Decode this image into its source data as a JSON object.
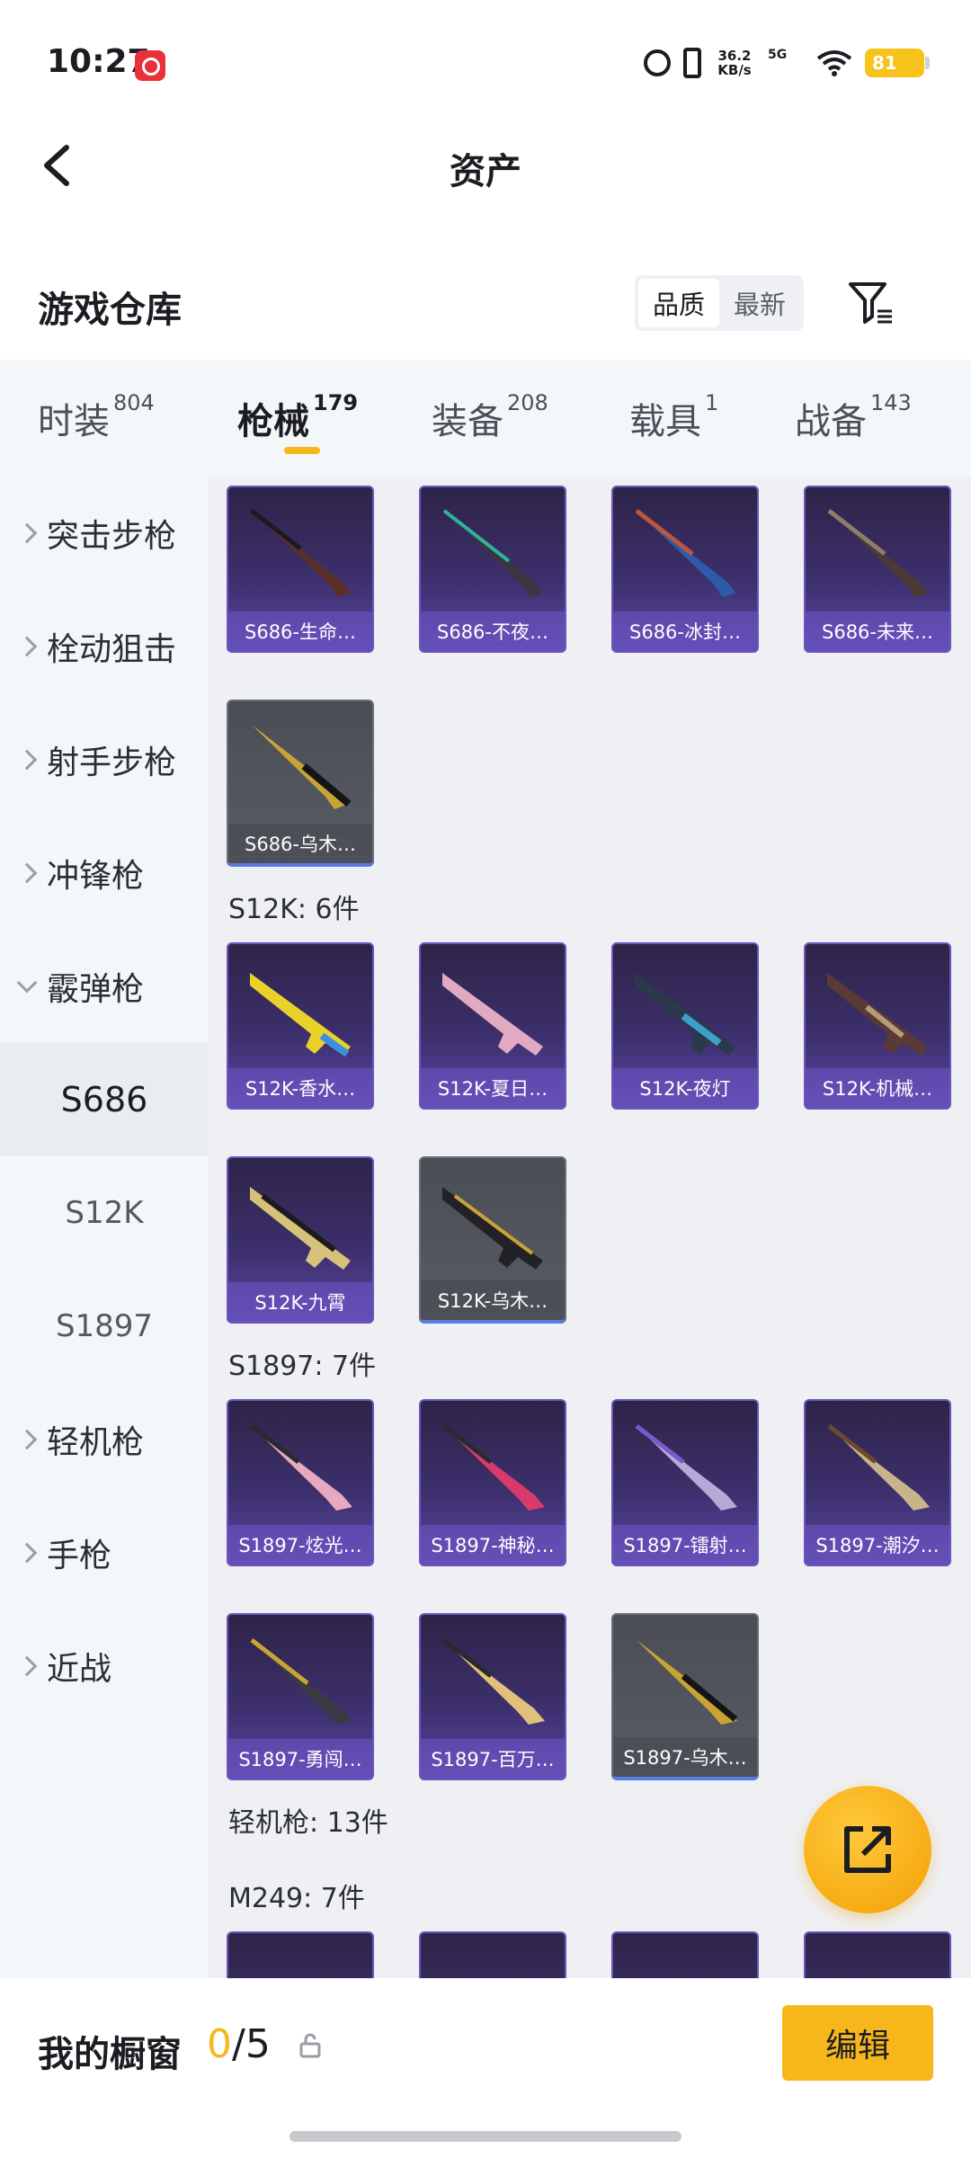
{
  "status_bar": {
    "time": "10:27",
    "speed_value": "36.2",
    "speed_unit": "KB/s",
    "network": "5G",
    "battery": "81"
  },
  "header": {
    "title": "资产",
    "back_icon": "chevron-left-icon"
  },
  "section": {
    "title": "游戏仓库",
    "sort_options": [
      "品质",
      "最新"
    ],
    "sort_selected": "品质",
    "filter_icon": "filter-icon"
  },
  "tabs": [
    {
      "label": "时装",
      "count": "804"
    },
    {
      "label": "枪械",
      "count": "179",
      "active": true
    },
    {
      "label": "装备",
      "count": "208"
    },
    {
      "label": "载具",
      "count": "1"
    },
    {
      "label": "战备",
      "count": "143"
    }
  ],
  "sidebar": {
    "items": [
      {
        "label": "突击步枪"
      },
      {
        "label": "栓动狙击"
      },
      {
        "label": "射手步枪"
      },
      {
        "label": "冲锋枪"
      },
      {
        "label": "霰弹枪",
        "expanded": true
      }
    ],
    "subitems": [
      {
        "label": "S686",
        "active": true
      },
      {
        "label": "S12K"
      },
      {
        "label": "S1897"
      }
    ],
    "items_after": [
      {
        "label": "轻机枪"
      },
      {
        "label": "手枪"
      },
      {
        "label": "近战"
      }
    ]
  },
  "groups": {
    "s686": {
      "items": [
        "S686-生命…",
        "S686-不夜…",
        "S686-冰封…",
        "S686-未来…",
        "S686-乌木…"
      ]
    },
    "s12k": {
      "label": "S12K: 6件",
      "items": [
        "S12K-香水…",
        "S12K-夏日…",
        "S12K-夜灯",
        "S12K-机械…",
        "S12K-九霄",
        "S12K-乌木…"
      ]
    },
    "s1897": {
      "label": "S1897: 7件",
      "items": [
        "S1897-炫光…",
        "S1897-神秘…",
        "S1897-镭射…",
        "S1897-潮汐…",
        "S1897-勇闯…",
        "S1897-百万…",
        "S1897-乌木…"
      ]
    },
    "lmg_label": "轻机枪: 13件",
    "m249_label": "M249: 7件"
  },
  "bottom": {
    "showcase_label": "我的橱窗",
    "showcase_current": "0",
    "showcase_total": "/5",
    "edit_label": "编辑"
  },
  "colors": {
    "accent": "#f7b71b",
    "card_purple": "#3c2f6b",
    "card_gray": "#55585f",
    "sidebar_bg": "#f4f7fa",
    "content_bg": "#eef0f3"
  }
}
